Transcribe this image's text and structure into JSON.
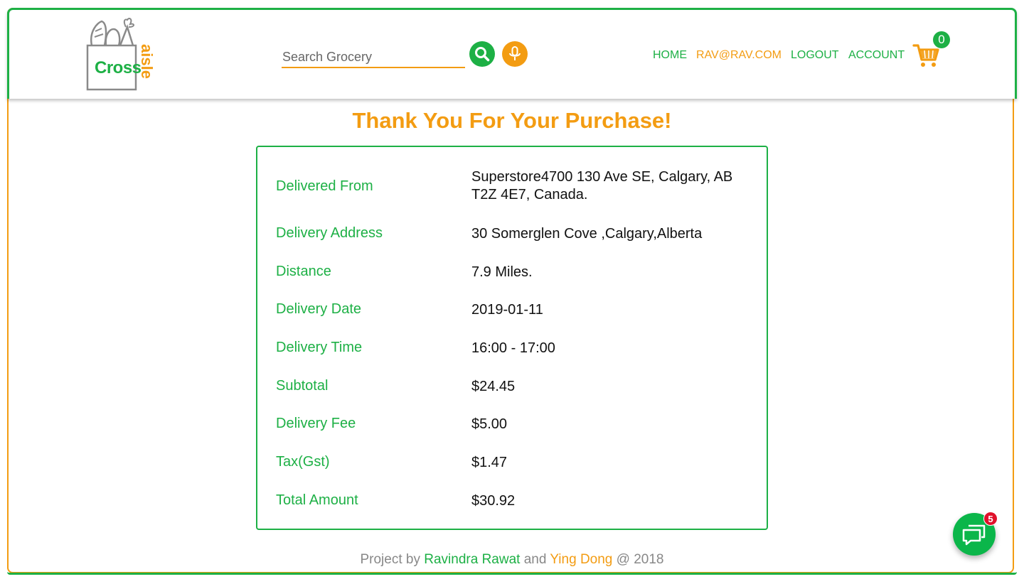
{
  "header": {
    "logo_word": "Cross",
    "logo_aisle": "aisle",
    "search_placeholder": "Search Grocery",
    "nav": {
      "home": "HOME",
      "email": "RAV@RAV.COM",
      "logout": "LOGOUT",
      "account": "ACCOUNT"
    },
    "cart_count": "0"
  },
  "page": {
    "title": "Thank You For Your Purchase!"
  },
  "order": [
    {
      "label": "Delivered From",
      "value": "Superstore4700 130 Ave SE, Calgary, AB T2Z 4E7, Canada."
    },
    {
      "label": "Delivery Address",
      "value": "30 Somerglen Cove ,Calgary,Alberta"
    },
    {
      "label": "Distance",
      "value": "7.9 Miles."
    },
    {
      "label": "Delivery Date",
      "value": "2019-01-11"
    },
    {
      "label": "Delivery Time",
      "value": "16:00 - 17:00"
    },
    {
      "label": "Subtotal",
      "value": "$24.45"
    },
    {
      "label": "Delivery Fee",
      "value": "$5.00"
    },
    {
      "label": "Tax(Gst)",
      "value": "$1.47"
    },
    {
      "label": "Total Amount",
      "value": "$30.92"
    }
  ],
  "footer": {
    "prefix": "Project by",
    "author1": "Ravindra Rawat",
    "and": "and",
    "author2": "Ying Dong",
    "suffix": "@ 2018"
  },
  "chat": {
    "badge_count": "5"
  },
  "colors": {
    "green": "#1db045",
    "orange": "#f39c12",
    "badge_red": "#e0112b"
  },
  "icons": [
    "grocery-bag-logo-icon",
    "search-icon",
    "microphone-icon",
    "shopping-cart-icon",
    "chat-icon"
  ]
}
